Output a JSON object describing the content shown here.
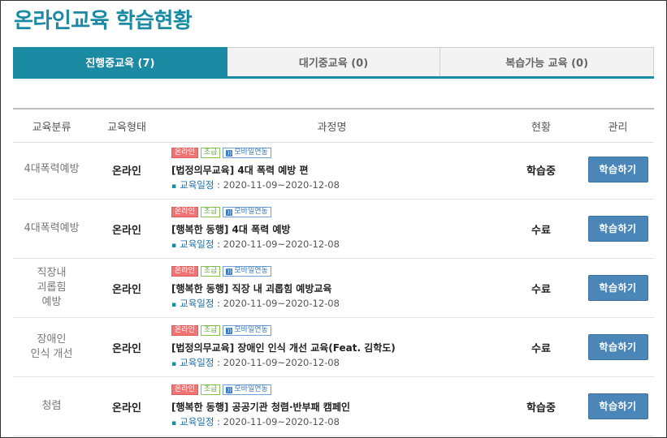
{
  "page_title": "온라인교육 학습현황",
  "tabs": [
    {
      "label": "진행중교육 (7)",
      "active": true
    },
    {
      "label": "대기중교육 (0)",
      "active": false
    },
    {
      "label": "복습가능 교육 (0)",
      "active": false
    }
  ],
  "table": {
    "headers": {
      "category": "교육분류",
      "type": "교육형태",
      "course": "과정명",
      "status": "현황",
      "manage": "관리"
    },
    "badges": {
      "online": "온라인",
      "level": "초급",
      "mobile": "모바일연동"
    },
    "schedule_label": "교육일정",
    "rows": [
      {
        "category": "4대폭력예방",
        "type": "온라인",
        "course_title": "[법정의무교육] 4대 폭력 예방 편",
        "schedule": " : 2020-11-09~2020-12-08",
        "status": "학습중",
        "button": "학습하기"
      },
      {
        "category": "4대폭력예방",
        "type": "온라인",
        "course_title": "[행복한 동행] 4대 폭력 예방",
        "schedule": " : 2020-11-09~2020-12-08",
        "status": "수료",
        "button": "학습하기"
      },
      {
        "category": "직장내 괴롭힘 예방",
        "type": "온라인",
        "course_title": "[행복한 동행] 직장 내 괴롭힘 예방교육",
        "schedule": " : 2020-11-09~2020-12-08",
        "status": "수료",
        "button": "학습하기"
      },
      {
        "category": "장애인 인식 개선",
        "type": "온라인",
        "course_title": "[법정의무교육] 장애인 인식 개선 교육(Feat. 김학도)",
        "schedule": " : 2020-11-09~2020-12-08",
        "status": "수료",
        "button": "학습하기"
      },
      {
        "category": "청렴",
        "type": "온라인",
        "course_title": "[행복한 동행] 공공기관 청렴·반부패 캠페인",
        "schedule": " : 2020-11-09~2020-12-08",
        "status": "학습중",
        "button": "학습하기"
      }
    ]
  },
  "colors": {
    "accent": "#1b8aa3",
    "button": "#4a86b8",
    "badge_online": "#f07474",
    "badge_level": "#6aa84f",
    "badge_mobile": "#3b7bbf"
  },
  "icons": {
    "mobile_badge": "rss-icon",
    "schedule_bullet": "bullet-icon"
  }
}
